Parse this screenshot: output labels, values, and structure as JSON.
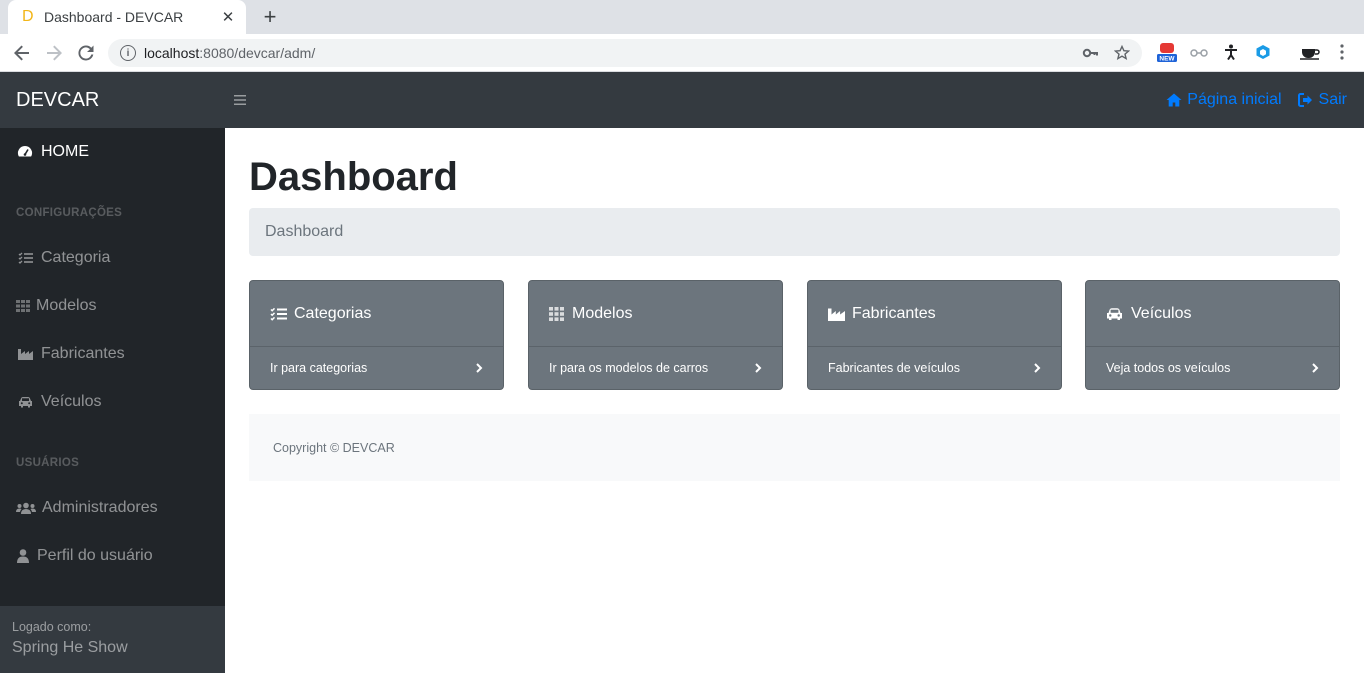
{
  "browser": {
    "tab_favicon": "D",
    "tab_title": "Dashboard - DEVCAR",
    "close_glyph": "✕",
    "newtab_glyph": "+",
    "url_host": "localhost",
    "url_rest": ":8080/devcar/adm/"
  },
  "sidebar": {
    "brand": "DEVCAR",
    "home": "HOME",
    "config_heading": "CONFIGURAÇÕES",
    "config_items": [
      {
        "label": "Categoria",
        "icon": "tasks-icon"
      },
      {
        "label": "Modelos",
        "icon": "th-icon"
      },
      {
        "label": "Fabricantes",
        "icon": "industry-icon"
      },
      {
        "label": "Veículos",
        "icon": "car-icon"
      }
    ],
    "users_heading": "USUÁRIOS",
    "users_items": [
      {
        "label": "Administradores",
        "icon": "users-icon"
      },
      {
        "label": "Perfil do usuário",
        "icon": "user-icon"
      }
    ],
    "logged_as": "Logado como:",
    "user_name": "Spring He Show"
  },
  "topnav": {
    "home_link": "Página inicial",
    "logout_link": "Sair",
    "link_color": "#007bff"
  },
  "main": {
    "title": "Dashboard",
    "breadcrumb": "Dashboard",
    "cards": [
      {
        "title": "Categorias",
        "link": "Ir para categorias",
        "icon": "tasks-icon"
      },
      {
        "title": "Modelos",
        "link": "Ir para os modelos de carros",
        "icon": "th-icon"
      },
      {
        "title": "Fabricantes",
        "link": "Fabricantes de veículos",
        "icon": "industry-icon"
      },
      {
        "title": "Veículos",
        "link": "Veja todos os veículos",
        "icon": "car-icon"
      }
    ],
    "footer": "Copyright © DEVCAR"
  }
}
